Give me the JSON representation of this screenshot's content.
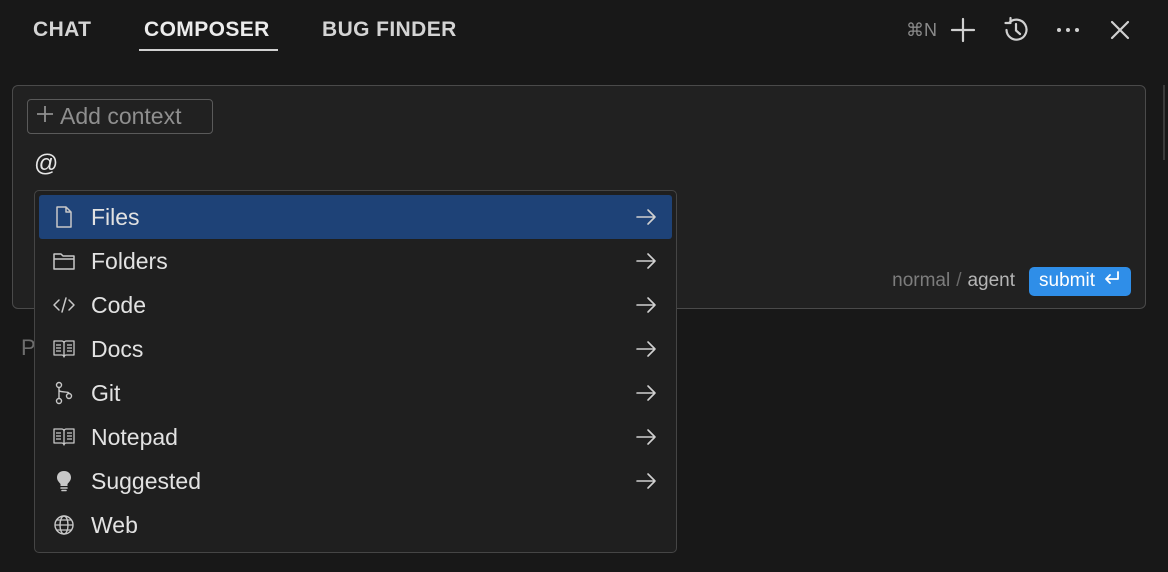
{
  "tabs": [
    {
      "label": "CHAT",
      "active": false
    },
    {
      "label": "COMPOSER",
      "active": true
    },
    {
      "label": "BUG FINDER",
      "active": false
    }
  ],
  "header_actions": {
    "new_shortcut": "⌘N",
    "icons": [
      "plus-icon",
      "history-icon",
      "more-icon",
      "close-icon"
    ]
  },
  "composer": {
    "add_context_label": "Add context",
    "input_value": "@",
    "mode_normal": "normal",
    "mode_separator": "/",
    "mode_agent": "agent",
    "submit_label": "submit"
  },
  "background_text": "P",
  "mention_menu": {
    "selected_index": 0,
    "items": [
      {
        "label": "Files",
        "icon": "file-icon",
        "has_submenu": true
      },
      {
        "label": "Folders",
        "icon": "folder-icon",
        "has_submenu": true
      },
      {
        "label": "Code",
        "icon": "code-icon",
        "has_submenu": true
      },
      {
        "label": "Docs",
        "icon": "book-icon",
        "has_submenu": true
      },
      {
        "label": "Git",
        "icon": "git-branch-icon",
        "has_submenu": true
      },
      {
        "label": "Notepad",
        "icon": "notepad-icon",
        "has_submenu": true
      },
      {
        "label": "Suggested",
        "icon": "lightbulb-icon",
        "has_submenu": true
      },
      {
        "label": "Web",
        "icon": "globe-icon",
        "has_submenu": false
      }
    ]
  },
  "colors": {
    "background": "#181818",
    "panel": "#212121",
    "selected": "#1e4277",
    "accent": "#2f8ee8"
  }
}
